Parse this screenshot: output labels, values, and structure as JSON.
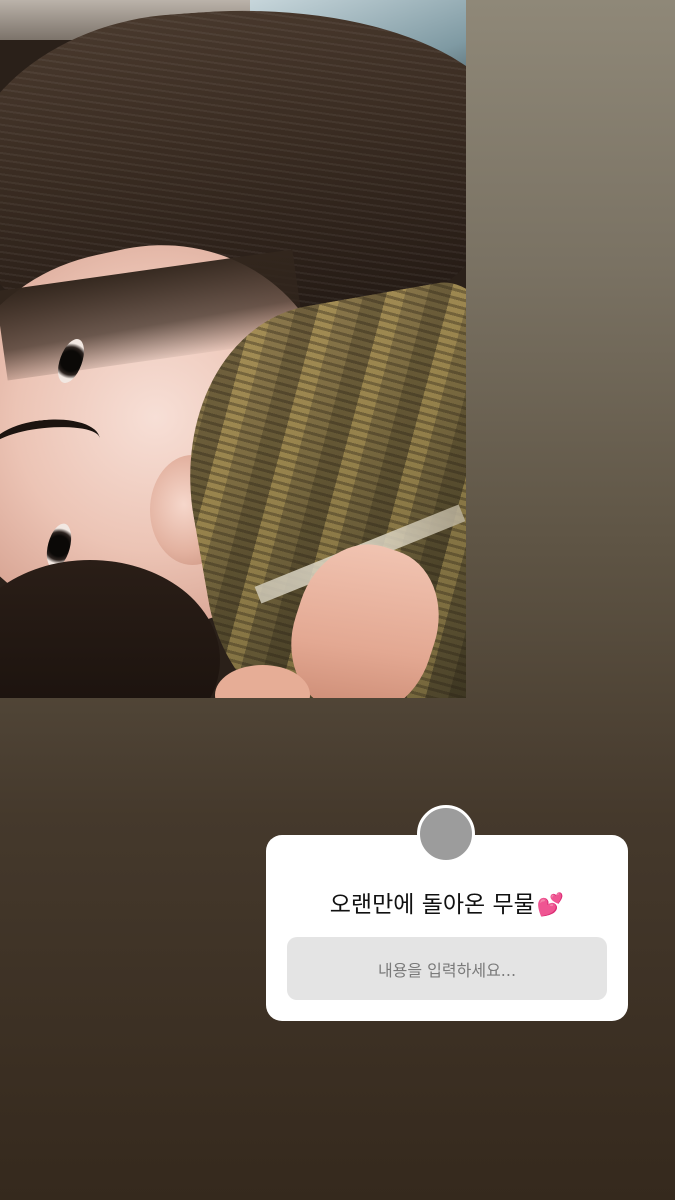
{
  "story": {
    "background_top": "#8f8878",
    "background_bottom": "#35291d"
  },
  "photo": {
    "description": "selfie-photo"
  },
  "question_sticker": {
    "title": "오랜만에 돌아온 무물",
    "emoji": "💕",
    "input_placeholder": "내용을 입력하세요...",
    "avatar_color": "#9c9c9c"
  }
}
